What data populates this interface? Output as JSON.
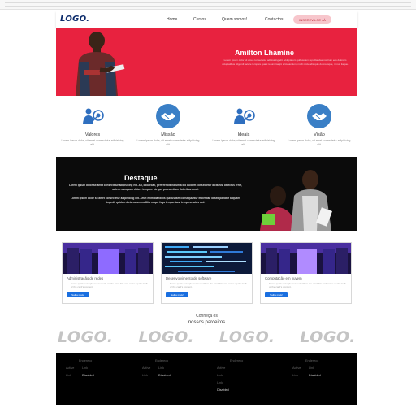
{
  "nav": {
    "logo": "LOGO.",
    "links": [
      "Home",
      "Cursos",
      "Quem somos!",
      "Contactos"
    ],
    "cta": "INSCREVA-SE JÁ"
  },
  "hero": {
    "title": "Amilton Lhamine",
    "text": "Lorem ipsum dolor sit amet consectetur adipisicing elit. Voluptatum quibusdam repudiandae nostrum eos dolorem voluptatibus eligendi facere tempore quasi rerum magni accusantium, modi reiciendis quis doloremque, minus itaque."
  },
  "values": [
    {
      "title": "Valores",
      "text": "Lorem ipsum dolor, sit amet consectetur adipisicing elit.",
      "icon": "target-icon"
    },
    {
      "title": "Missão",
      "text": "Lorem ipsum dolor, sit amet consectetur adipisicing elit.",
      "icon": "handshake-icon"
    },
    {
      "title": "Ideais",
      "text": "Lorem ipsum dolor, sit amet consectetur adipisicing elit.",
      "icon": "target-icon"
    },
    {
      "title": "Visão",
      "text": "Lorem ipsum dolor, sit amet consectetur adipisicing elit.",
      "icon": "handshake-icon"
    }
  ],
  "destaque": {
    "title": "Destaque",
    "p1": "Lorem ipsum dolor sit amet consectetur adipisicing elit. Ab, obcaecati, perferendis harum a illo quidem consectetur dicta nisi delectus error, autem numquam dolore tempore hic quo praesentium doloribus amet.",
    "p2": "Lorem ipsum dolor sit amet consectetur adipisicing elit. Amet enim blanditiis quibusdam consequuntur molestiae id sed pariatur aliquam, impedit quidem dicta earum mollitia neque fuga temporibus, tempora nobis sed."
  },
  "cards": [
    {
      "title": "Administração de redes",
      "text": "Some quick example text to build on the card title and make up the bulk of the card's content.",
      "button": "Saiba mais!"
    },
    {
      "title": "Desenvolvimento de software",
      "text": "Some quick example text to build on the card title and make up the bulk of the card's content.",
      "button": "Saiba mais!"
    },
    {
      "title": "Computação em nuvem",
      "text": "Some quick example text to build on the card title and make up the bulk of the card's content.",
      "button": "Saiba mais!"
    }
  ],
  "partners": {
    "line1": "Conheça os",
    "line2": "nossos parceiros",
    "logos": [
      "LOGO.",
      "LOGO.",
      "LOGO.",
      "LOGO."
    ]
  },
  "footer": {
    "columns": [
      {
        "heading": "Endereço",
        "rows": [
          [
            "Active",
            "Link"
          ],
          [
            "Link",
            "Disabled"
          ]
        ]
      },
      {
        "heading": "Endereço",
        "rows": [
          [
            "Active",
            "Link"
          ],
          [
            "Link",
            "Disabled"
          ]
        ]
      },
      {
        "heading": "Endereço",
        "rows": [
          [
            "Active"
          ],
          [
            "Link"
          ],
          [
            "Link"
          ],
          [
            "Disabled"
          ]
        ]
      },
      {
        "heading": "Endereço",
        "rows": [
          [
            "Active",
            "Link"
          ],
          [
            "Link",
            "Disabled"
          ]
        ]
      }
    ]
  },
  "colors": {
    "brand_red": "#e8223f",
    "brand_blue": "#3a7fc6",
    "button_blue": "#1a6fe0",
    "dark": "#0b0b0b"
  }
}
